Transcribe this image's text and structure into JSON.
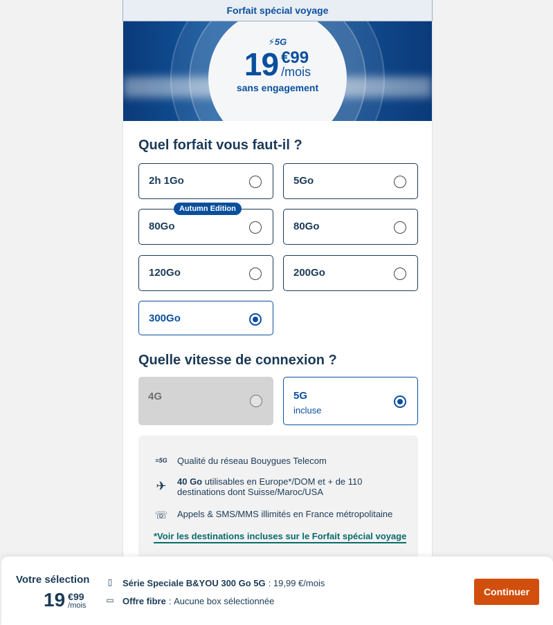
{
  "card": {
    "header": "Forfait spécial voyage",
    "banner": {
      "network_tag": "5G",
      "price_euros": "19",
      "price_cents": "€99",
      "price_unit": "/mois",
      "engagement": "sans engagement"
    }
  },
  "plan_section": {
    "title": "Quel forfait vous faut-il ?",
    "badge": "Autumn Edition",
    "options": [
      {
        "label": "2h 1Go",
        "selected": false
      },
      {
        "label": "5Go",
        "selected": false
      },
      {
        "label": "80Go",
        "selected": false
      },
      {
        "label": "80Go",
        "selected": false
      },
      {
        "label": "120Go",
        "selected": false
      },
      {
        "label": "200Go",
        "selected": false
      },
      {
        "label": "300Go",
        "selected": true
      }
    ]
  },
  "speed_section": {
    "title": "Quelle vitesse de connexion ?",
    "options": [
      {
        "label": "4G",
        "sub": "",
        "selected": false,
        "disabled": true
      },
      {
        "label": "5G",
        "sub": "incluse",
        "selected": true,
        "disabled": false
      }
    ]
  },
  "features": {
    "items": [
      {
        "icon": "5g-icon",
        "icon_text": "5G",
        "text": "Qualité du réseau Bouygues Telecom"
      },
      {
        "icon": "airplane-icon",
        "bold": "40 Go",
        "text": " utilisables en Europe*/DOM et + de 110",
        "text2": "destinations dont Suisse/Maroc/USA"
      },
      {
        "icon": "phone-icon",
        "text": "Appels & SMS/MMS illimités en France métropolitaine"
      }
    ],
    "link": "*Voir les destinations incluses sur le Forfait spécial voyage"
  },
  "footer": {
    "title": "Votre sélection",
    "price_euros": "19",
    "price_cents": "€99",
    "price_unit": "/mois",
    "lines": [
      {
        "icon": "sim-card-icon",
        "label": "Série Speciale B&YOU 300 Go 5G",
        "sep": " :",
        "value": "19,99 €/mois"
      },
      {
        "icon": "fiber-box-icon",
        "label": "Offre fibre",
        "sep": " :",
        "value": "Aucune box sélectionnée"
      }
    ],
    "cta": "Continuer"
  },
  "colors": {
    "brand_blue": "#0a4f9e",
    "navy_text": "#1b3a57",
    "cta_orange": "#d24e0d"
  }
}
